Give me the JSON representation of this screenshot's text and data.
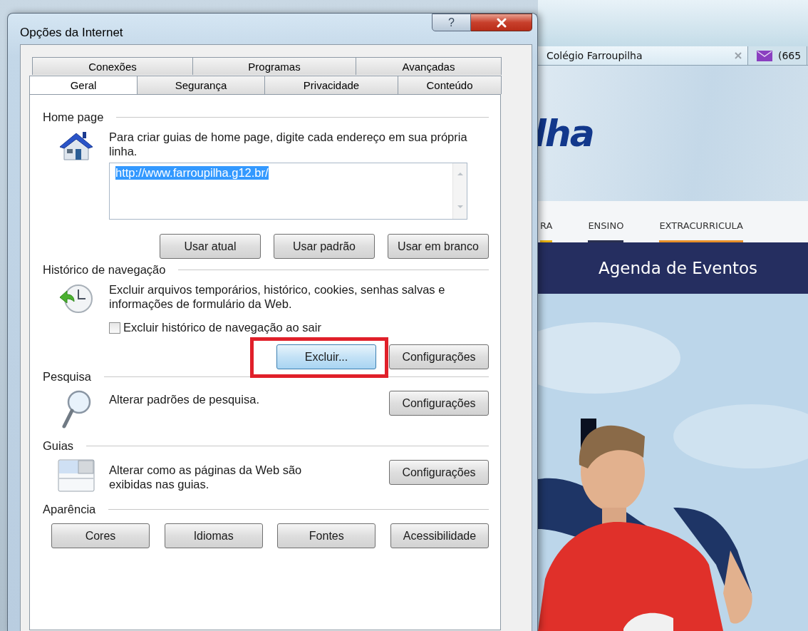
{
  "dialog": {
    "title": "Opções da Internet",
    "help_button": "?",
    "tab_rows": [
      {
        "tabs": [
          {
            "label": "Conexões",
            "selected": false
          },
          {
            "label": "Programas",
            "selected": false
          },
          {
            "label": "Avançadas",
            "selected": false
          }
        ]
      },
      {
        "tabs": [
          {
            "label": "Geral",
            "selected": true
          },
          {
            "label": "Segurança",
            "selected": false
          },
          {
            "label": "Privacidade",
            "selected": false
          },
          {
            "label": "Conteúdo",
            "selected": false
          }
        ]
      }
    ],
    "sections": [
      {
        "kind": "home_page",
        "heading": "Home page",
        "description": "Para criar guias de home page, digite cada endereço em sua própria linha.",
        "field": {
          "value": "http://www.farroupilha.g12.br/",
          "selected": true
        },
        "buttons": [
          {
            "label": "Usar atual",
            "focused": false,
            "framed": false
          },
          {
            "label": "Usar padrão",
            "focused": false,
            "framed": false
          },
          {
            "label": "Usar em branco",
            "focused": false,
            "framed": false
          }
        ]
      },
      {
        "kind": "history",
        "heading": "Histórico de navegação",
        "description": "Excluir arquivos temporários, histórico, cookies, senhas salvas e informações de formulário da Web.",
        "checkbox": {
          "label": "Excluir histórico de navegação ao sair",
          "checked": false
        },
        "buttons": [
          {
            "label": "Excluir...",
            "focused": true,
            "framed": true
          },
          {
            "label": "Configurações",
            "focused": false,
            "framed": false
          }
        ]
      },
      {
        "kind": "search",
        "heading": "Pesquisa",
        "description": "Alterar padrões de pesquisa.",
        "buttons": [
          {
            "label": "Configurações",
            "focused": false,
            "framed": false
          }
        ]
      },
      {
        "kind": "tabs",
        "heading": "Guias",
        "description": "Alterar como as páginas da Web são exibidas nas guias.",
        "buttons": [
          {
            "label": "Configurações",
            "focused": false,
            "framed": false
          }
        ]
      },
      {
        "kind": "appearance",
        "heading": "Aparência",
        "buttons": [
          {
            "label": "Cores",
            "focused": false,
            "framed": false
          },
          {
            "label": "Idiomas",
            "focused": false,
            "framed": false
          },
          {
            "label": "Fontes",
            "focused": false,
            "framed": false
          },
          {
            "label": "Acessibilidade",
            "focused": false,
            "framed": false
          }
        ]
      }
    ]
  },
  "browser": {
    "tabs": [
      {
        "kind": "page",
        "title": "Colégio Farroupilha",
        "selected": true
      },
      {
        "kind": "mail",
        "title": "(665",
        "selected": false
      }
    ],
    "logo_text": "lha",
    "nav": [
      {
        "label": "RA",
        "color": "#e8b010"
      },
      {
        "label": "ENSINO",
        "color": "#2a3050"
      },
      {
        "label": "EXTRACURRICULA",
        "color": "#e8902a"
      }
    ],
    "banner": "Agenda de Eventos"
  }
}
